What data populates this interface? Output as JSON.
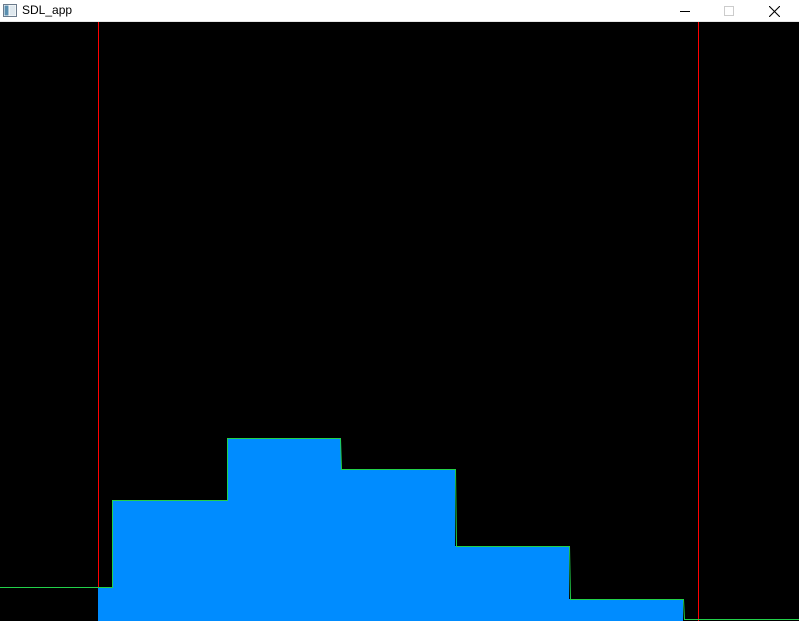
{
  "window": {
    "title": "SDL_app",
    "buttons": {
      "minimize_icon": "minimize-icon",
      "maximize_icon": "maximize-icon",
      "close_icon": "close-icon"
    }
  },
  "colors": {
    "background": "#000000",
    "fill": "#008cff",
    "outline": "#22d14a",
    "bound_line": "#ff0000"
  }
}
